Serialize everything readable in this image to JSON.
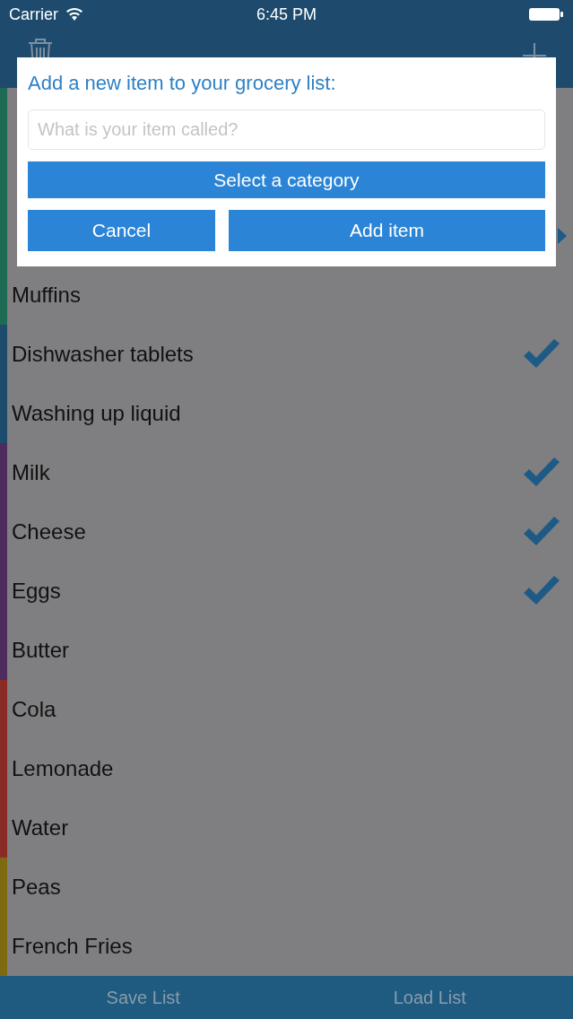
{
  "status_bar": {
    "carrier": "Carrier",
    "time": "6:45 PM"
  },
  "items": [
    {
      "color": "#1e6b55",
      "checked": false,
      "disclosure": false
    },
    {
      "color": "#1e6b55",
      "checked": false,
      "disclosure": false
    },
    {
      "color": "#1e6b55",
      "checked": false,
      "disclosure": true
    },
    {
      "name": "Muffins",
      "color": "#1e6b55",
      "checked": false,
      "disclosure": false
    },
    {
      "name": "Dishwasher tablets",
      "color": "#1d4b6b",
      "checked": true,
      "disclosure": false
    },
    {
      "name": "Washing up liquid",
      "color": "#1d4b6b",
      "checked": false,
      "disclosure": false
    },
    {
      "name": "Milk",
      "color": "#4e2b5d",
      "checked": true,
      "disclosure": false
    },
    {
      "name": "Cheese",
      "color": "#4e2b5d",
      "checked": true,
      "disclosure": false
    },
    {
      "name": "Eggs",
      "color": "#4e2b5d",
      "checked": true,
      "disclosure": false
    },
    {
      "name": "Butter",
      "color": "#4e2b5d",
      "checked": false,
      "disclosure": false
    },
    {
      "name": "Cola",
      "color": "#8a2b26",
      "checked": false,
      "disclosure": false
    },
    {
      "name": "Lemonade",
      "color": "#8a2b26",
      "checked": false,
      "disclosure": false
    },
    {
      "name": "Water",
      "color": "#8a2b26",
      "checked": false,
      "disclosure": false
    },
    {
      "name": "Peas",
      "color": "#7e6a10",
      "checked": false,
      "disclosure": false
    },
    {
      "name": "French Fries",
      "color": "#7e6a10",
      "checked": false,
      "disclosure": false
    }
  ],
  "toolbar": [
    "Save List",
    "Load List"
  ],
  "dialog": {
    "title": "Add a new item to your grocery list:",
    "placeholder": "What is your item called?",
    "category_button": "Select a category",
    "buttons": [
      "Cancel",
      "Add item"
    ]
  }
}
